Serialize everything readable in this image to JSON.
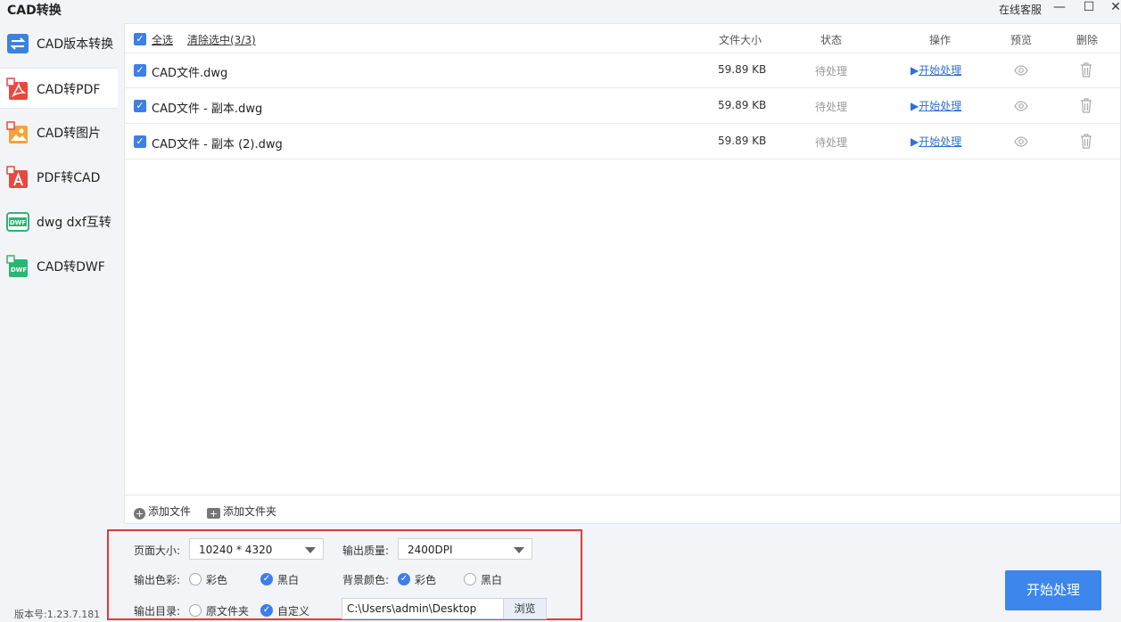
{
  "app": {
    "title": "CAD转换",
    "online_service": "在线客服",
    "version": "版本号:1.23.7.181"
  },
  "window_controls": {
    "minimize": "—",
    "maximize": "☐",
    "close": "✕"
  },
  "sidebar": {
    "items": [
      {
        "label": "CAD版本转换",
        "icon": "version-convert-icon",
        "active": false
      },
      {
        "label": "CAD转PDF",
        "icon": "pdf-icon",
        "active": true
      },
      {
        "label": "CAD转图片",
        "icon": "image-icon",
        "active": false
      },
      {
        "label": "PDF转CAD",
        "icon": "pdf-to-cad-icon",
        "active": false
      },
      {
        "label": "dwg dxf互转",
        "icon": "dwg-dxf-icon",
        "active": false
      },
      {
        "label": "CAD转DWF",
        "icon": "dwf-icon",
        "active": false
      }
    ]
  },
  "file_list": {
    "select_all": "全选",
    "clear_selection": "清除选中(3/3)",
    "columns": {
      "size": "文件大小",
      "status": "状态",
      "action": "操作",
      "preview": "预览",
      "delete": "删除"
    },
    "files": [
      {
        "name": "CAD文件.dwg",
        "size": "59.89 KB",
        "status": "待处理",
        "action": "开始处理",
        "checked": true
      },
      {
        "name": "CAD文件 - 副本.dwg",
        "size": "59.89 KB",
        "status": "待处理",
        "action": "开始处理",
        "checked": true
      },
      {
        "name": "CAD文件 - 副本 (2).dwg",
        "size": "59.89 KB",
        "status": "待处理",
        "action": "开始处理",
        "checked": true
      }
    ]
  },
  "add_bar": {
    "add_file": "添加文件",
    "add_folder": "添加文件夹"
  },
  "settings": {
    "page_size_label": "页面大小:",
    "page_size_value": "10240 * 4320",
    "quality_label": "输出质量:",
    "quality_value": "2400DPI",
    "color_label": "输出色彩:",
    "color_options": [
      "彩色",
      "黑白"
    ],
    "color_selected": "黑白",
    "bg_label": "背景颜色:",
    "bg_options": [
      "彩色",
      "黑白"
    ],
    "bg_selected": "彩色",
    "dir_label": "输出目录:",
    "dir_options": [
      "原文件夹",
      "自定义"
    ],
    "dir_selected": "自定义",
    "dir_path": "C:\\Users\\admin\\Desktop",
    "browse": "浏览"
  },
  "start_button": "开始处理",
  "colors": {
    "accent": "#3c86ee",
    "highlight_border": "#e03a3a",
    "link": "#2f6fd6"
  }
}
